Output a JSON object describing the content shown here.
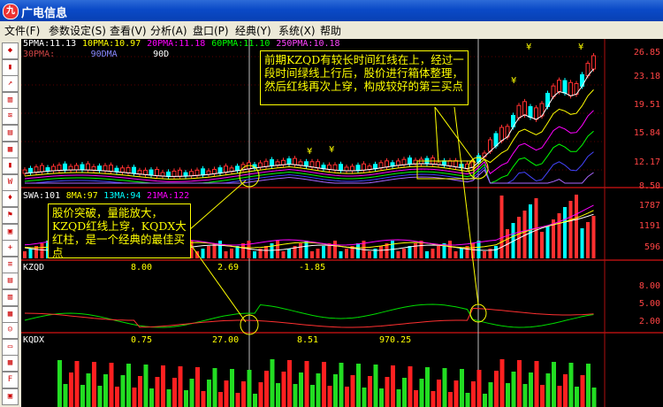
{
  "window": {
    "title": "广电信息",
    "logo_glyph": "九"
  },
  "menu": {
    "items": [
      {
        "label": "文件(F)"
      },
      {
        "label": "参数设定(S)"
      },
      {
        "label": "查看(V)"
      },
      {
        "label": "分析(A)"
      },
      {
        "label": "盘口(P)"
      },
      {
        "label": "经典(Y)"
      },
      {
        "label": "系统(X)"
      },
      {
        "label": "帮助"
      }
    ]
  },
  "toolbar": {
    "icons": [
      "kline-icon",
      "candle-icon",
      "trend-icon",
      "volume-icon",
      "compare-icon",
      "bar-icon",
      "grid-icon",
      "candle-icon",
      "w-icon",
      "bell-icon",
      "flag-icon",
      "calendar-icon",
      "plus-icon",
      "list-icon",
      "news-icon",
      "report-icon",
      "chart-icon",
      "people-icon",
      "doc-icon",
      "table-icon",
      "f10-icon",
      "save-icon"
    ]
  },
  "panels": {
    "price": {
      "ma_labels_row1": [
        {
          "text": "5PMA:11.13",
          "color": "#ffffff"
        },
        {
          "text": "10PMA:10.97",
          "color": "#ffff00"
        },
        {
          "text": "20PMA:11.18",
          "color": "#ff00ff"
        },
        {
          "text": "60PMA:11.10",
          "color": "#00ff00"
        },
        {
          "text": "250PMA:10.18",
          "color": "#ff44ff"
        }
      ],
      "ma_labels_row2": [
        {
          "text": "30PMA:",
          "color": "#cc4444"
        },
        {
          "text": "90DMA",
          "color": "#8888ff"
        },
        {
          "text": "90D",
          "color": "#ffffff"
        }
      ],
      "yaxis": [
        "26.85",
        "23.18",
        "19.51",
        "15.84",
        "12.17",
        "8.50"
      ]
    },
    "volume": {
      "labels": [
        {
          "text": "SWA:101",
          "color": "#ffffff"
        },
        {
          "text": "8MA:97",
          "color": "#ffff00"
        },
        {
          "text": "13MA:94",
          "color": "#00ffff"
        },
        {
          "text": "21MA:122",
          "color": "#ff00ff"
        }
      ],
      "yaxis": [
        "1787",
        "1191",
        "596"
      ]
    },
    "kzqd": {
      "labels": [
        {
          "text": "KZQD",
          "color": "#ffffff"
        },
        {
          "text": "8.00",
          "color": "#ffff00"
        },
        {
          "text": "2.69",
          "color": "#ffff00"
        },
        {
          "text": "-1.85",
          "color": "#ffff00"
        }
      ],
      "yaxis": [
        "8.00",
        "5.00",
        "2.00"
      ]
    },
    "kqdx": {
      "labels": [
        {
          "text": "KQDX",
          "color": "#ffffff"
        },
        {
          "text": "0.75",
          "color": "#ffff00"
        },
        {
          "text": "27.00",
          "color": "#ffff00"
        },
        {
          "text": "8.51",
          "color": "#ffff00"
        },
        {
          "text": "970.25",
          "color": "#ffff00"
        }
      ]
    }
  },
  "annotations": {
    "third_buy": "前期KZQD有较长时间红线在上，经过一段时间绿线上行后，股价进行箱体整理，然后红线再次上穿，构成较好的第三买点",
    "first_buy": "股价突破，量能放大，KZQD红线上穿，KQDX大红柱，是一个经典的最佳买点"
  }
}
